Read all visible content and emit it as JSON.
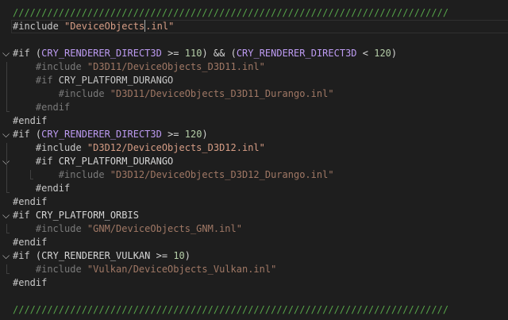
{
  "editor": {
    "lines": [
      {
        "tokens": [
          {
            "t": "////////////////////////////////////////////////////////////////////////////",
            "c": "t-comment"
          }
        ],
        "indent": 0,
        "fold": ""
      },
      {
        "tokens": [
          {
            "t": "#include",
            "c": "t-pre-active"
          },
          {
            "t": " ",
            "c": "t-op"
          },
          {
            "t": "\"DeviceObjects",
            "c": "t-str"
          },
          {
            "t": "|CURSOR|",
            "c": "cursor"
          },
          {
            "t": ".inl\"",
            "c": "t-str"
          }
        ],
        "indent": 0,
        "fold": "",
        "current": true
      },
      {
        "tokens": [],
        "indent": 0,
        "fold": ""
      },
      {
        "tokens": [
          {
            "t": "#if",
            "c": "t-pre-active"
          },
          {
            "t": " (",
            "c": "t-op"
          },
          {
            "t": "CRY_RENDERER_DIRECT3D",
            "c": "t-macro"
          },
          {
            "t": " >= ",
            "c": "t-op"
          },
          {
            "t": "110",
            "c": "t-num"
          },
          {
            "t": ") && (",
            "c": "t-op"
          },
          {
            "t": "CRY_RENDERER_DIRECT3D",
            "c": "t-macro"
          },
          {
            "t": " < ",
            "c": "t-op"
          },
          {
            "t": "120",
            "c": "t-num"
          },
          {
            "t": ")",
            "c": "t-op"
          }
        ],
        "indent": 0,
        "fold": "v"
      },
      {
        "tokens": [
          {
            "t": "#include",
            "c": "t-pre-dim"
          },
          {
            "t": " ",
            "c": "t-op"
          },
          {
            "t": "\"D3D11/DeviceObjects_D3D11.inl\"",
            "c": "t-str-dim"
          }
        ],
        "indent": 1,
        "fold": ""
      },
      {
        "tokens": [
          {
            "t": "#if",
            "c": "t-pre-dim"
          },
          {
            "t": " CRY_PLATFORM_DURANGO",
            "c": "t-macro-dim"
          }
        ],
        "indent": 1,
        "fold": ""
      },
      {
        "tokens": [
          {
            "t": "#include",
            "c": "t-pre-dim"
          },
          {
            "t": " ",
            "c": "t-op"
          },
          {
            "t": "\"D3D11/DeviceObjects_D3D11_Durango.inl\"",
            "c": "t-str-dim"
          }
        ],
        "indent": 2,
        "fold": ""
      },
      {
        "tokens": [
          {
            "t": "#endif",
            "c": "t-pre-dim"
          }
        ],
        "indent": 1,
        "fold": ""
      },
      {
        "tokens": [
          {
            "t": "#endif",
            "c": "t-pre-active"
          }
        ],
        "indent": 0,
        "fold": ""
      },
      {
        "tokens": [
          {
            "t": "#if",
            "c": "t-pre-active"
          },
          {
            "t": " (",
            "c": "t-op"
          },
          {
            "t": "CRY_RENDERER_DIRECT3D",
            "c": "t-macro"
          },
          {
            "t": " >= ",
            "c": "t-op"
          },
          {
            "t": "120",
            "c": "t-num"
          },
          {
            "t": ")",
            "c": "t-op"
          }
        ],
        "indent": 0,
        "fold": "v"
      },
      {
        "tokens": [
          {
            "t": "#include",
            "c": "t-pre-active"
          },
          {
            "t": " ",
            "c": "t-op"
          },
          {
            "t": "\"D3D12/DeviceObjects_D3D12.inl\"",
            "c": "t-str"
          }
        ],
        "indent": 1,
        "fold": ""
      },
      {
        "tokens": [
          {
            "t": "#if",
            "c": "t-pre-active"
          },
          {
            "t": " CRY_PLATFORM_DURANGO",
            "c": "t-op"
          }
        ],
        "indent": 1,
        "fold": "v"
      },
      {
        "tokens": [
          {
            "t": "#include",
            "c": "t-pre-dim"
          },
          {
            "t": " ",
            "c": "t-op"
          },
          {
            "t": "\"D3D12/DeviceObjects_D3D12_Durango.inl\"",
            "c": "t-str-dim"
          }
        ],
        "indent": 2,
        "fold": ""
      },
      {
        "tokens": [
          {
            "t": "#endif",
            "c": "t-pre-active"
          }
        ],
        "indent": 1,
        "fold": ""
      },
      {
        "tokens": [
          {
            "t": "#endif",
            "c": "t-pre-active"
          }
        ],
        "indent": 0,
        "fold": ""
      },
      {
        "tokens": [
          {
            "t": "#if",
            "c": "t-pre-active"
          },
          {
            "t": " CRY_PLATFORM_ORBIS",
            "c": "t-op"
          }
        ],
        "indent": 0,
        "fold": "v"
      },
      {
        "tokens": [
          {
            "t": "#include",
            "c": "t-pre-dim"
          },
          {
            "t": " ",
            "c": "t-op"
          },
          {
            "t": "\"GNM/DeviceObjects_GNM.inl\"",
            "c": "t-str-dim"
          }
        ],
        "indent": 1,
        "fold": ""
      },
      {
        "tokens": [
          {
            "t": "#endif",
            "c": "t-pre-active"
          }
        ],
        "indent": 0,
        "fold": ""
      },
      {
        "tokens": [
          {
            "t": "#if",
            "c": "t-pre-active"
          },
          {
            "t": " (",
            "c": "t-op"
          },
          {
            "t": "CRY_RENDERER_VULKAN",
            "c": "t-op"
          },
          {
            "t": " >= ",
            "c": "t-op"
          },
          {
            "t": "10",
            "c": "t-num"
          },
          {
            "t": ")",
            "c": "t-op"
          }
        ],
        "indent": 0,
        "fold": "v"
      },
      {
        "tokens": [
          {
            "t": "#include",
            "c": "t-pre-dim"
          },
          {
            "t": " ",
            "c": "t-op"
          },
          {
            "t": "\"Vulkan/DeviceObjects_Vulkan.inl\"",
            "c": "t-str-dim"
          }
        ],
        "indent": 1,
        "fold": ""
      },
      {
        "tokens": [
          {
            "t": "#endif",
            "c": "t-pre-active"
          }
        ],
        "indent": 0,
        "fold": ""
      },
      {
        "tokens": [],
        "indent": 0,
        "fold": ""
      },
      {
        "tokens": [
          {
            "t": "////////////////////////////////////////////////////////////////////////////",
            "c": "t-comment"
          }
        ],
        "indent": 0,
        "fold": ""
      }
    ]
  },
  "icons": {
    "fold_expanded": "chevron-down-icon",
    "fold_glyph": "⌵"
  }
}
